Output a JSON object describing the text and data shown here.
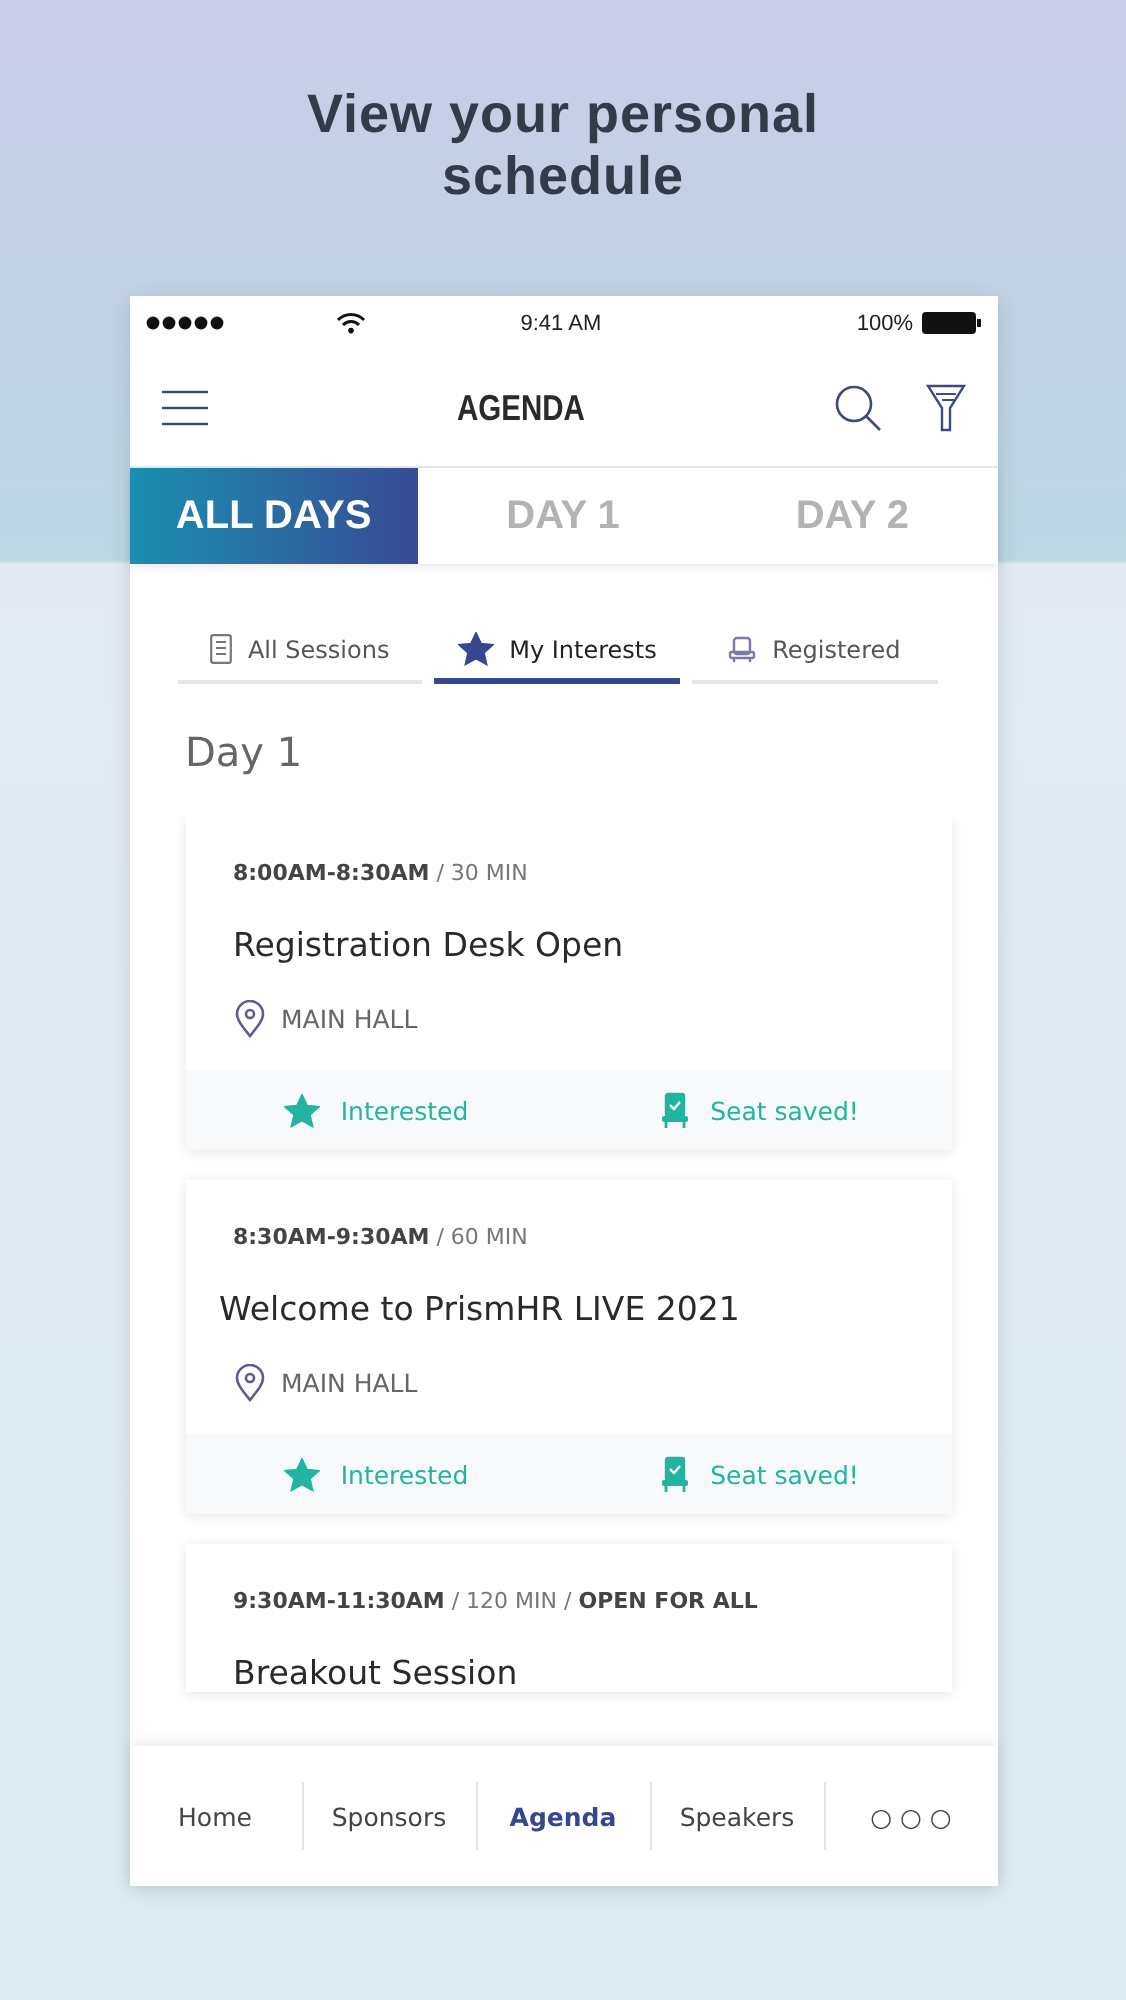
{
  "headline": "View your personal schedule",
  "status_bar": {
    "time": "9:41 AM",
    "battery": "100%"
  },
  "header": {
    "title": "AGENDA"
  },
  "day_tabs": [
    {
      "label": "ALL DAYS",
      "selected": true
    },
    {
      "label": "DAY 1",
      "selected": false
    },
    {
      "label": "DAY 2",
      "selected": false
    }
  ],
  "filter_tabs": [
    {
      "label": "All Sessions",
      "kind": "sessions",
      "selected": false
    },
    {
      "label": "My Interests",
      "kind": "interests",
      "selected": true
    },
    {
      "label": "Registered",
      "kind": "registered",
      "selected": false
    }
  ],
  "section_title": "Day 1",
  "sessions": [
    {
      "meta": "**8:00AM-8:30AM** / 30 MIN",
      "title": "Registration Desk Open",
      "location": "MAIN HALL",
      "interested": true,
      "interest_label": "Interested",
      "seat_saved": true,
      "seat_label": "Seat saved!"
    },
    {
      "meta": "**8:30AM-9:30AM** / 60 MIN",
      "title": "Welcome to PrismHR LIVE 2021",
      "location": "MAIN HALL",
      "interested": true,
      "interest_label": "Interested",
      "seat_saved": true,
      "seat_label": "Seat saved!"
    },
    {
      "meta": "**9:30AM-11:30AM** / 120 MIN / **OPEN FOR ALL**",
      "title": "Breakout Session"
    }
  ],
  "bottom_nav": [
    {
      "label": "Home",
      "selected": false
    },
    {
      "label": "Sponsors",
      "selected": false
    },
    {
      "label": "Agenda",
      "selected": true
    },
    {
      "label": "Speakers",
      "selected": false
    },
    {
      "label": "○ ○ ○",
      "selected": false
    }
  ]
}
